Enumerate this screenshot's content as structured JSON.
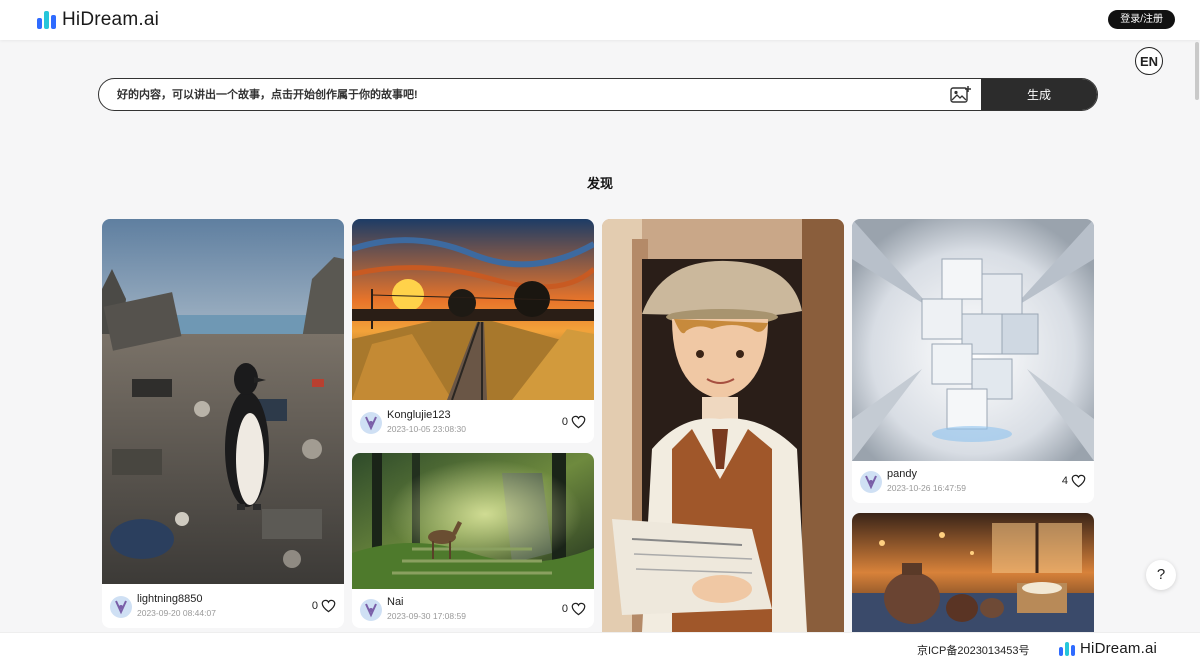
{
  "header": {
    "logo_text": "HiDream.ai",
    "login_label": "登录/注册",
    "brand_colors": [
      "#2f6bff",
      "#26c6da",
      "#1a1a1a"
    ]
  },
  "lang_toggle": {
    "label": "EN"
  },
  "search": {
    "placeholder": "好的内容，可以讲出一个故事，点击开始创作属于你的故事吧!",
    "image_upload_icon": "image-plus-icon",
    "generate_label": "生成"
  },
  "discover": {
    "title": "发现",
    "cards": [
      {
        "image": "penguin-on-trash-beach",
        "user": "lightning8850",
        "time": "2023-09-20 08:44:07",
        "likes": "0"
      },
      {
        "image": "sunset-railway-painting",
        "user": "Konglujie123",
        "time": "2023-10-05 23:08:30",
        "likes": "0"
      },
      {
        "image": "deer-forest-stairs",
        "user": "Nai",
        "time": "2023-09-30 17:08:59",
        "likes": "0"
      },
      {
        "image": "boy-with-newspaper",
        "user": "",
        "time": "",
        "likes": ""
      },
      {
        "image": "white-cubes-tunnel",
        "user": "pandy",
        "time": "2023-10-26 16:47:59",
        "likes": "4"
      },
      {
        "image": "teapots-on-table",
        "user": "",
        "time": "",
        "likes": ""
      }
    ]
  },
  "help": {
    "label": "?"
  },
  "footer": {
    "icp": "京ICP备2023013453号",
    "logo_text": "HiDream.ai"
  }
}
